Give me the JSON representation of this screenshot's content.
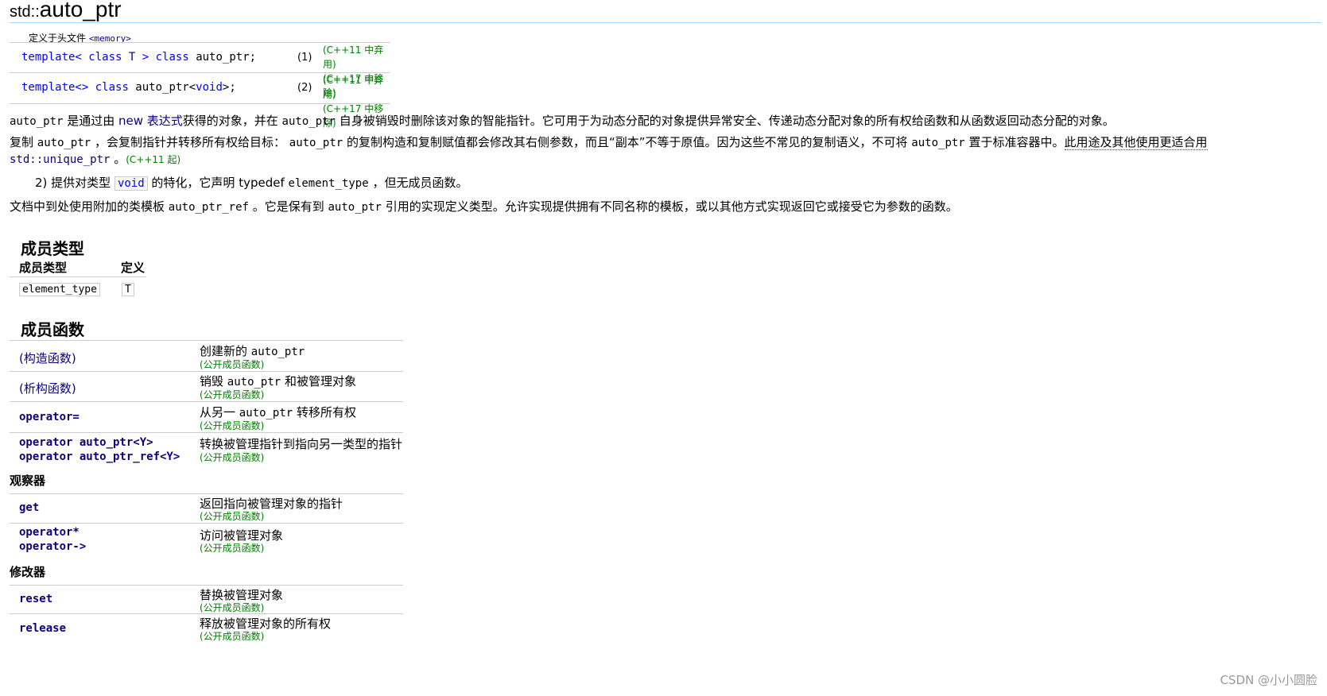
{
  "title": {
    "namespace": "std::",
    "name": "auto_ptr"
  },
  "defined_in": {
    "label": "定义于头文件",
    "header": "<memory>"
  },
  "declarations": [
    {
      "kw1": "template<",
      "kw2": " class ",
      "tp": "T",
      "rest1": " > ",
      "kw3": "class",
      "rest2": " auto_ptr;",
      "num": "(1)",
      "std1": "(C++11 中弃用)",
      "std2": "(C++17 中移除)"
    },
    {
      "kw1": "template<>",
      "kw2": " class",
      "rest1": " auto_ptr<",
      "kw3": "void",
      "rest2": ">;",
      "num": "(2)",
      "std1": "(C++11 中弃用)",
      "std2": "(C++17 中移除)"
    }
  ],
  "para1": {
    "code1": "auto_ptr",
    "t1": " 是通过由 ",
    "link1": "new 表达式",
    "t2": "获得的对象，并在 ",
    "code2": "auto_ptr",
    "t3": " 自身被销毁时删除该对象的智能指针。它可用于为动态分配的对象提供异常安全、传递动态分配对象的所有权给函数和从函数返回动态分配的对象。"
  },
  "para2": {
    "t1": "复制 ",
    "code1": "auto_ptr",
    "t2": " ，会复制指针并转移所有权给目标： ",
    "code2": "auto_ptr",
    "t3": " 的复制构造和复制赋值都会修改其右侧参数，而且“副本”不等于原值。因为这些不常见的复制语义，不可将 ",
    "code3": "auto_ptr",
    "t4": " 置于标准容器中。",
    "t5": "此用途及其他使用更适合用",
    "code4": "std::unique_ptr",
    "t6": " 。",
    "std": "(C++11 起)"
  },
  "para3": {
    "t1": "2) 提供对类型 ",
    "code1": "void",
    "t2": " 的特化，它声明 typedef ",
    "code2": "element_type",
    "t3": " ，但无成员函数。"
  },
  "para4": {
    "t1": "文档中到处使用附加的类模板 ",
    "code1": "auto_ptr_ref",
    "t2": " 。它是保有到 ",
    "code2": "auto_ptr",
    "t3": " 引用的实现定义类型。允许实现提供拥有不同名称的模板，或以其他方式实现返回它或接受它为参数的函数。"
  },
  "member_types": {
    "heading": "成员类型",
    "col1": "成员类型",
    "col2": "定义",
    "row": {
      "name": "element_type",
      "def": "T"
    }
  },
  "member_functions": {
    "heading": "成员函数",
    "public": "(公开成员函数)",
    "ctor": {
      "name": "(构造函数)",
      "d1": "创建新的 ",
      "code": "auto_ptr",
      "d2": ""
    },
    "dtor": {
      "name": "(析构函数)",
      "d1": "销毁 ",
      "code": "auto_ptr",
      "d2": " 和被管理对象"
    },
    "assign": {
      "name": "operator=",
      "d1": "从另一 ",
      "code": "auto_ptr",
      "d2": " 转移所有权"
    },
    "conv": {
      "name1": "operator auto_ptr<Y>",
      "name2": "operator auto_ptr_ref<Y>",
      "desc": "转换被管理指针到指向另一类型的指针"
    },
    "observers": "观察器",
    "get": {
      "name": "get",
      "desc": "返回指向被管理对象的指针"
    },
    "deref": {
      "name1": "operator*",
      "name2": "operator->",
      "desc": "访问被管理对象"
    },
    "modifiers": "修改器",
    "reset": {
      "name": "reset",
      "desc": "替换被管理对象"
    },
    "release": {
      "name": "release",
      "desc": "释放被管理对象的所有权"
    }
  },
  "watermark": "CSDN @小小圆脸"
}
